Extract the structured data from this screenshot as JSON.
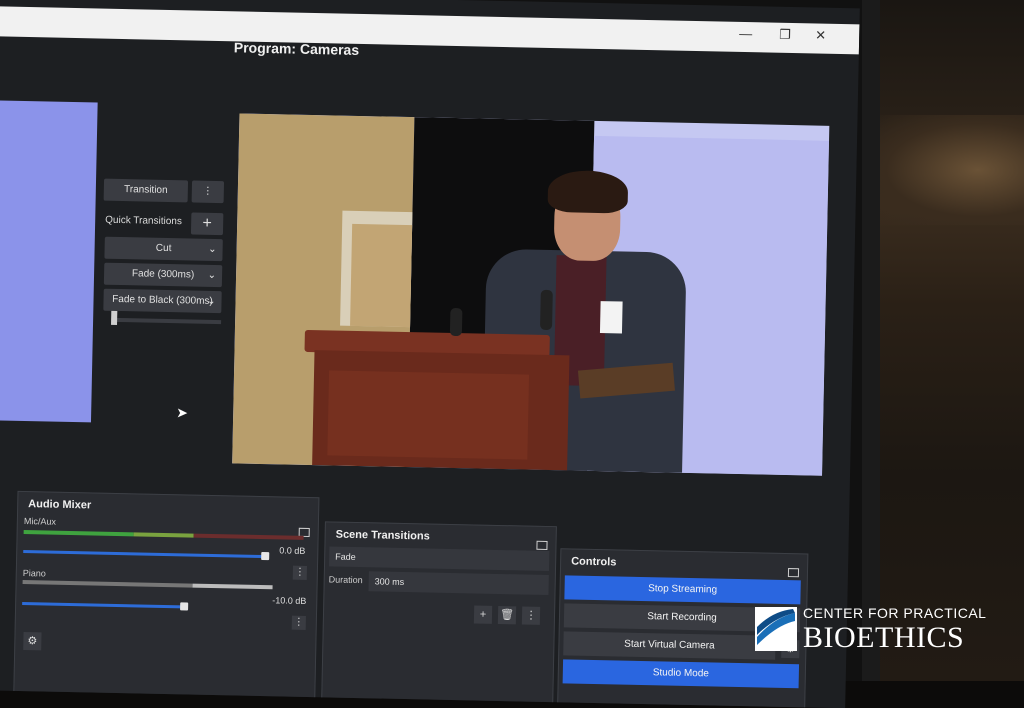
{
  "program": {
    "header": "Program: Cameras"
  },
  "transitions_panel": {
    "transition_button": "Transition",
    "quick_transitions_label": "Quick Transitions",
    "items": [
      "Cut",
      "Fade (300ms)",
      "Fade to Black (300ms)"
    ]
  },
  "audio_mixer": {
    "title": "Audio Mixer",
    "channels": [
      {
        "name": "Mic/Aux",
        "db": "0.0 dB"
      },
      {
        "name": "Piano",
        "db": "-10.0 dB"
      }
    ]
  },
  "scene_transitions": {
    "title": "Scene Transitions",
    "transition": "Fade",
    "duration_label": "Duration",
    "duration_value": "300 ms"
  },
  "controls": {
    "title": "Controls",
    "buttons": [
      "Stop Streaming",
      "Start Recording",
      "Start Virtual Camera",
      "Studio Mode"
    ]
  },
  "colors": {
    "accent_blue": "#2a66e0",
    "preview_blue": "#8b93ea"
  },
  "logo": {
    "line1": "CENTER FOR PRACTICAL",
    "line2": "BIOETHICS"
  }
}
